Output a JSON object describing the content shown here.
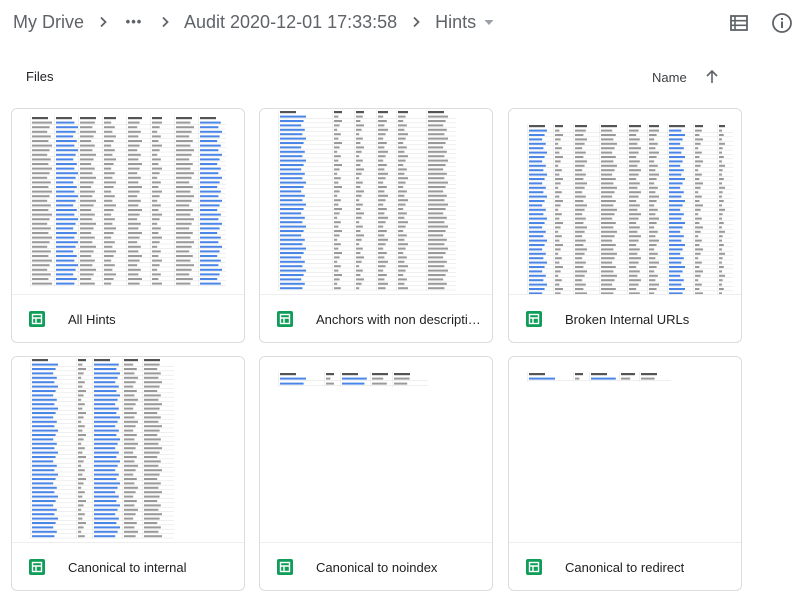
{
  "breadcrumb": {
    "root": "My Drive",
    "more": "•••",
    "folder": "Audit 2020-12-01 17:33:58",
    "current": "Hints"
  },
  "section": {
    "files_label": "Files",
    "sort_label": "Name"
  },
  "icons": {
    "chevron": "chevron-right-icon",
    "dropdown": "arrow-drop-down-icon",
    "list_view": "list-view-icon",
    "info": "info-icon",
    "sort": "arrow-up-icon",
    "sheets": "google-sheets-icon"
  },
  "colors": {
    "sheets_green": "#0f9d58",
    "link_blue": "#1a73e8"
  },
  "files": [
    {
      "name": "All Hints"
    },
    {
      "name": "Anchors with non descriptive text"
    },
    {
      "name": "Broken Internal URLs"
    },
    {
      "name": "Canonical to internal"
    },
    {
      "name": "Canonical to noindex"
    },
    {
      "name": "Canonical to redirect"
    }
  ]
}
